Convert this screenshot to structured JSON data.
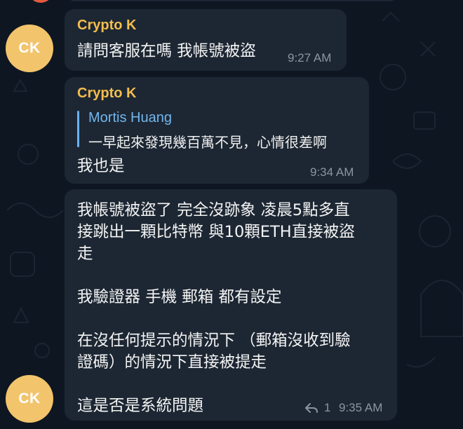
{
  "chat": {
    "messages": [
      {
        "avatar_initials": "CK",
        "sender": "Crypto K",
        "text": "請問客服在嗎 我帳號被盜",
        "time": "9:27 AM"
      },
      {
        "sender": "Crypto K",
        "reply_to": {
          "name": "Mortis Huang",
          "text": "一早起來發現幾百萬不見，心情很差啊"
        },
        "text": "我也是",
        "time": "9:34 AM"
      },
      {
        "avatar_initials": "CK",
        "text": "我帳號被盜了 完全沒跡象 凌晨5點多直\n接跳出一顆比特幣 與10顆ETH直接被盜\n走\n\n我驗證器 手機 郵箱 都有設定\n\n在沒任何提示的情況下 （郵箱沒收到驗\n證碼）的情況下直接被提走\n\n這是否是系統問題",
        "reply_count": "1",
        "time": "9:35 AM"
      }
    ]
  },
  "icons": {
    "reply": "reply-arrow-icon"
  },
  "colors": {
    "background": "#0e1621",
    "bubble": "#1d2733",
    "sender_name": "#f3bd4d",
    "reply_name": "#72b6ee",
    "avatar": "#f2c46c",
    "timestamp": "#8a96a3"
  }
}
